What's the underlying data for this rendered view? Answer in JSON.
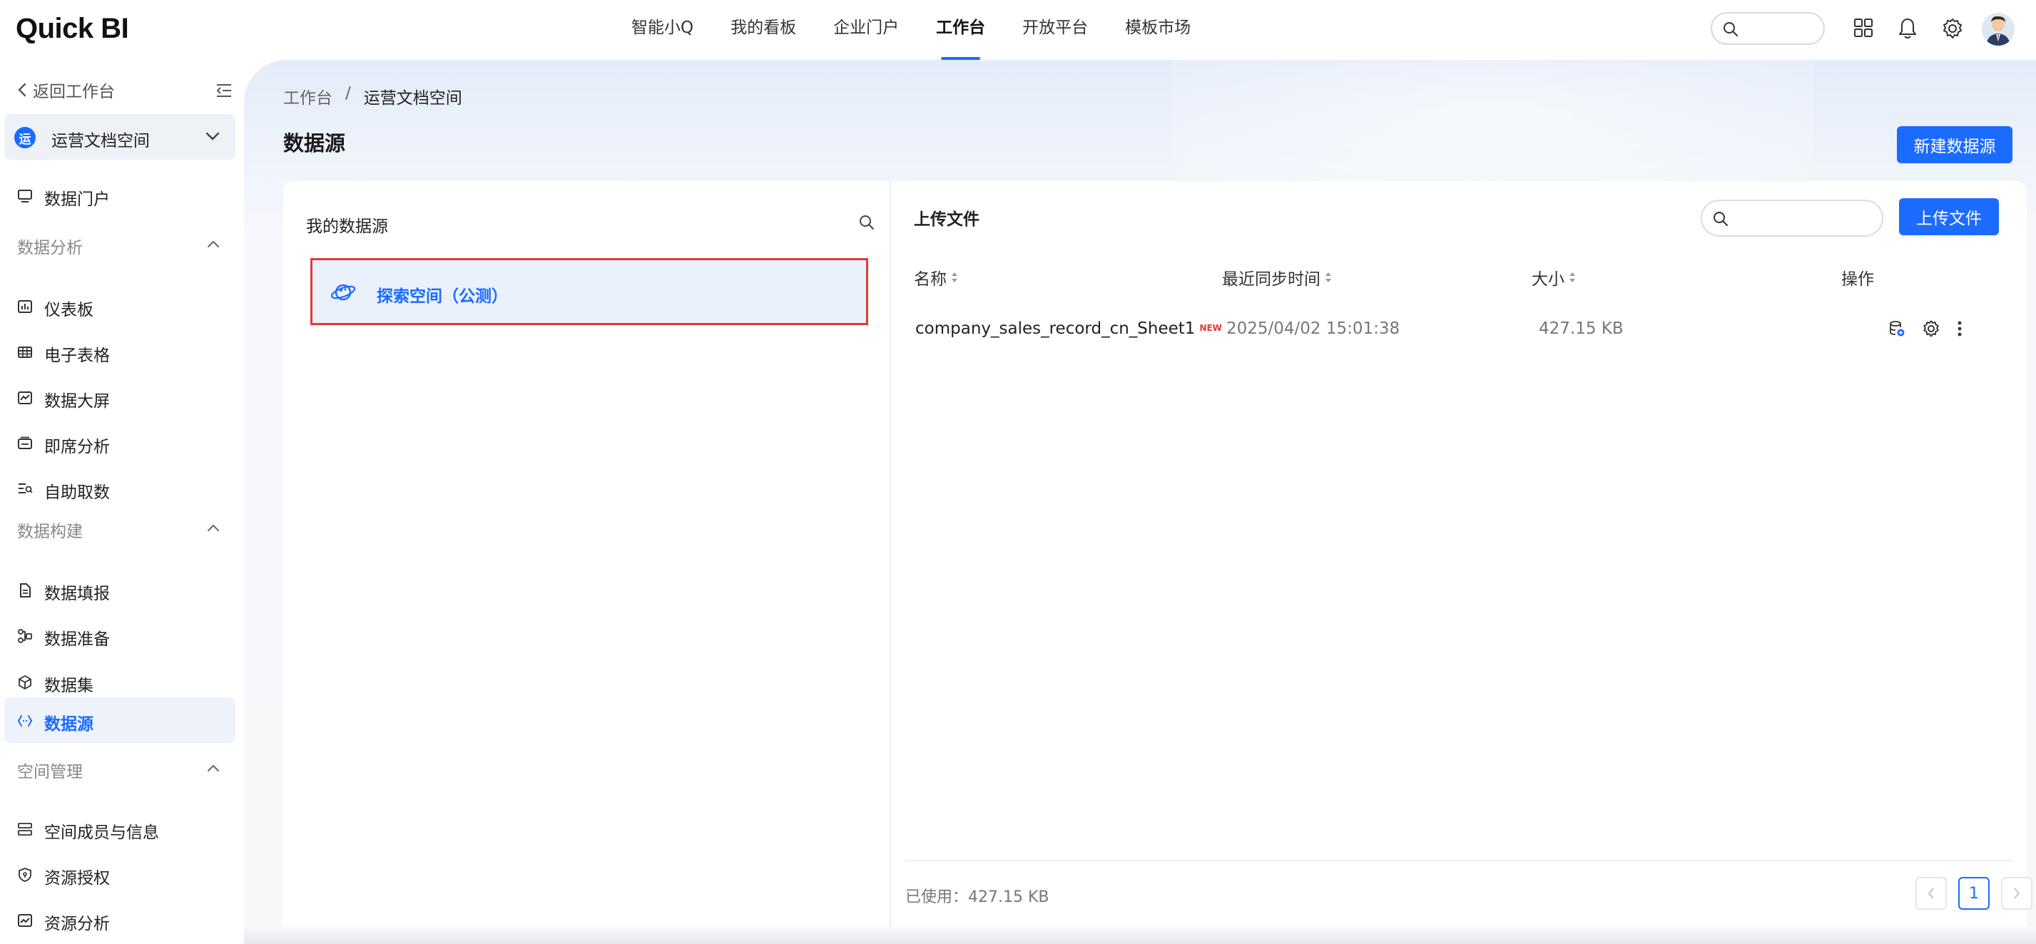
{
  "brand": {
    "logo_text": "Quick BI"
  },
  "topnav": {
    "items": [
      {
        "label": "智能小Q"
      },
      {
        "label": "我的看板"
      },
      {
        "label": "企业门户"
      },
      {
        "label": "工作台"
      },
      {
        "label": "开放平台"
      },
      {
        "label": "模板市场"
      }
    ],
    "active_index": 3,
    "search_placeholder": ""
  },
  "sidebar": {
    "back_label": "返回工作台",
    "space": {
      "badge": "运",
      "name": "运营文档空间"
    },
    "portal_label": "数据门户",
    "groups": [
      {
        "label": "数据分析",
        "items": [
          "仪表板",
          "电子表格",
          "数据大屏",
          "即席分析",
          "自助取数"
        ]
      },
      {
        "label": "数据构建",
        "items": [
          "数据填报",
          "数据准备",
          "数据集",
          "数据源"
        ]
      },
      {
        "label": "空间管理",
        "items": [
          "空间成员与信息",
          "资源授权",
          "资源分析"
        ]
      }
    ],
    "active_item": "数据源"
  },
  "breadcrumb": {
    "root": "工作台",
    "separator": "/",
    "current": "运营文档空间"
  },
  "page": {
    "title": "数据源",
    "new_button": "新建数据源"
  },
  "left_panel": {
    "title": "我的数据源",
    "items": [
      {
        "label": "探索空间（公测）"
      }
    ]
  },
  "right_panel": {
    "title": "上传文件",
    "search_placeholder": "",
    "upload_button": "上传文件",
    "columns": {
      "name": "名称",
      "sync_time": "最近同步时间",
      "size": "大小",
      "ops": "操作"
    },
    "rows": [
      {
        "name": "company_sales_record_cn_Sheet1",
        "tag": "NEW",
        "sync_time": "2025/04/02 15:01:38",
        "size": "427.15 KB"
      }
    ],
    "footer": {
      "used_label": "已使用：427.15 KB",
      "current_page": "1"
    }
  },
  "colors": {
    "accent": "#1b6bff",
    "highlight_border": "#e03b3b",
    "new_tag": "#e53935"
  }
}
